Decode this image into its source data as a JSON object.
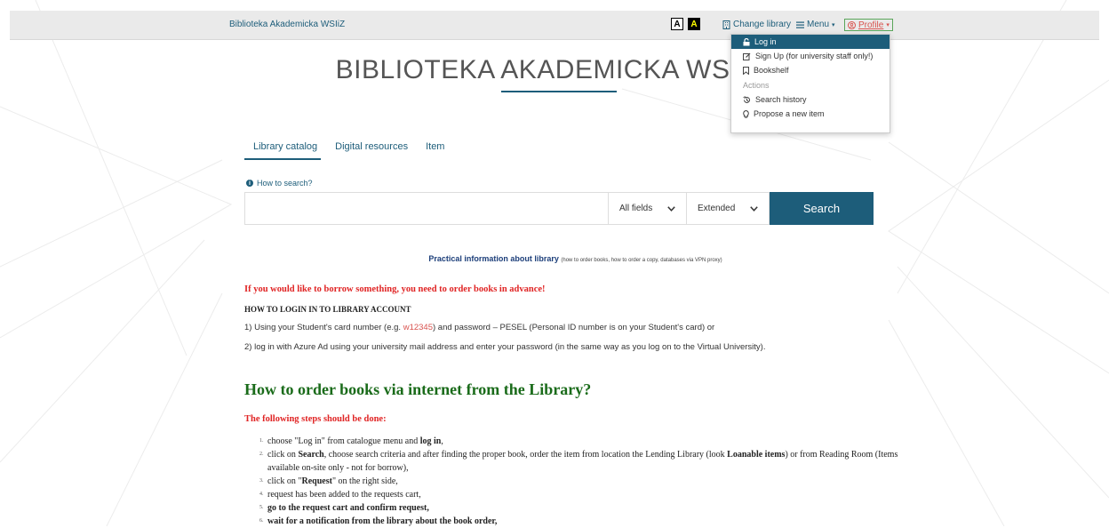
{
  "topbar": {
    "brand": "Biblioteka Akademicka WSIiZ",
    "contrast_normal": "A",
    "contrast_high": "A",
    "change_library": "Change library",
    "menu": "Menu",
    "profile": "Profile"
  },
  "profile_menu": {
    "items": [
      {
        "label": "Log in",
        "icon": "lock-icon"
      },
      {
        "label": "Sign Up (for university staff only!)",
        "icon": "edit-icon"
      },
      {
        "label": "Bookshelf",
        "icon": "bookmark-icon"
      }
    ],
    "actions_header": "Actions",
    "actions": [
      {
        "label": "Search history",
        "icon": "history-icon"
      },
      {
        "label": "Propose a new item",
        "icon": "lightbulb-icon"
      }
    ]
  },
  "title": "BIBLIOTEKA AKADEMICKA WSIiZ",
  "tabs": [
    "Library catalog",
    "Digital resources",
    "Item"
  ],
  "how_to_search": "How to search?",
  "search": {
    "placeholder": "",
    "field_select": "All fields",
    "mode_select": "Extended",
    "button": "Search"
  },
  "practical": {
    "bold": "Practical information about library",
    "small": "(how to order books, how to order a copy, databases via VPN proxy)"
  },
  "notice": "If you would like to borrow something, you need to order books in advance!",
  "login_heading": "HOW TO LOGIN IN TO LIBRARY ACCOUNT",
  "login_p1": {
    "before": "1) Using your Student's card number  (e.g. ",
    "highlight": "w12345",
    "after": ") and password – PESEL (Personal ID number is on your Student's card) or"
  },
  "login_p2": "2) log in with Azure Ad using your university mail address and enter your password (in the same way as you log on to the Virtual University).",
  "order_heading": "How to order books via internet from the Library?",
  "steps_heading": "The following steps should be done:",
  "steps": [
    {
      "num": "1.",
      "parts": [
        {
          "t": "choose \"Log in\" from catalogue menu and ",
          "b": false
        },
        {
          "t": "log in",
          "b": true
        },
        {
          "t": ",",
          "b": false
        }
      ]
    },
    {
      "num": "2.",
      "parts": [
        {
          "t": "click on ",
          "b": false
        },
        {
          "t": "Search",
          "b": true
        },
        {
          "t": ", choose search criteria and after finding the proper book, order the item from location the Lending Library (look ",
          "b": false
        },
        {
          "t": "Loanable items",
          "b": true
        },
        {
          "t": ") or from Reading Room (Items available on-site only - not for borrow),",
          "b": false
        }
      ]
    },
    {
      "num": "3.",
      "parts": [
        {
          "t": "click on \"",
          "b": false
        },
        {
          "t": "Request",
          "b": true
        },
        {
          "t": "\" on the right side,",
          "b": false
        }
      ]
    },
    {
      "num": "4.",
      "parts": [
        {
          "t": "request has been added to the requests cart,",
          "b": false
        }
      ]
    },
    {
      "num": "5.",
      "parts": [
        {
          "t": "go to the request cart and confirm request,",
          "b": true
        }
      ]
    },
    {
      "num": "6.",
      "parts": [
        {
          "t": "wait for a notification from the library about the book order,",
          "b": true
        }
      ]
    }
  ],
  "colors": {
    "accent": "#1d5d7a",
    "notice_red": "#e02424",
    "heading_green": "#1a6b1a"
  }
}
